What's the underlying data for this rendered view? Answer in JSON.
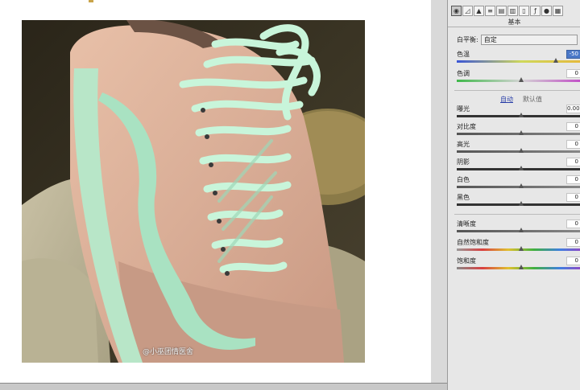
{
  "canvas": {
    "watermark": "@小巫团情医舍"
  },
  "panel": {
    "toolbar_icons": [
      "aperture-icon",
      "tone-curve-icon",
      "mountain-icon",
      "detail-icon",
      "hsl-icon",
      "split-toning-icon",
      "lens-icon",
      "fx-icon",
      "camera-icon",
      "presets-icon"
    ],
    "title": "基本",
    "white_balance": {
      "label": "白平衡:",
      "value": "自定"
    },
    "temperature": {
      "label": "色温",
      "value": "-50",
      "fraction": 0.77
    },
    "tint": {
      "label": "色调",
      "value": "0",
      "fraction": 0.5
    },
    "auto_label": "自动",
    "default_label": "默认值",
    "exposure": {
      "label": "曝光",
      "value": "0.00",
      "fraction": 0.5
    },
    "contrast": {
      "label": "对比度",
      "value": "0",
      "fraction": 0.5
    },
    "highlights": {
      "label": "高光",
      "value": "0",
      "fraction": 0.5
    },
    "shadows": {
      "label": "阴影",
      "value": "0",
      "fraction": 0.5
    },
    "whites": {
      "label": "白色",
      "value": "0",
      "fraction": 0.5
    },
    "blacks": {
      "label": "黑色",
      "value": "0",
      "fraction": 0.5
    },
    "clarity": {
      "label": "清晰度",
      "value": "0",
      "fraction": 0.5
    },
    "vibrance": {
      "label": "自然饱和度",
      "value": "0",
      "fraction": 0.5
    },
    "saturation": {
      "label": "饱和度",
      "value": "0",
      "fraction": 0.5
    }
  }
}
